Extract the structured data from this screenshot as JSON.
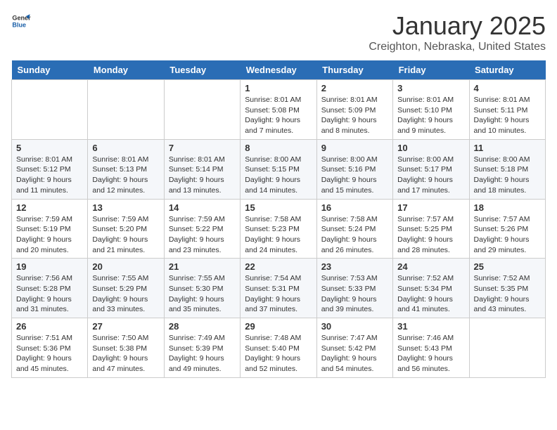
{
  "logo": {
    "general": "General",
    "blue": "Blue"
  },
  "title": "January 2025",
  "location": "Creighton, Nebraska, United States",
  "days_of_week": [
    "Sunday",
    "Monday",
    "Tuesday",
    "Wednesday",
    "Thursday",
    "Friday",
    "Saturday"
  ],
  "weeks": [
    [
      {
        "day": "",
        "detail": ""
      },
      {
        "day": "",
        "detail": ""
      },
      {
        "day": "",
        "detail": ""
      },
      {
        "day": "1",
        "detail": "Sunrise: 8:01 AM\nSunset: 5:08 PM\nDaylight: 9 hours\nand 7 minutes."
      },
      {
        "day": "2",
        "detail": "Sunrise: 8:01 AM\nSunset: 5:09 PM\nDaylight: 9 hours\nand 8 minutes."
      },
      {
        "day": "3",
        "detail": "Sunrise: 8:01 AM\nSunset: 5:10 PM\nDaylight: 9 hours\nand 9 minutes."
      },
      {
        "day": "4",
        "detail": "Sunrise: 8:01 AM\nSunset: 5:11 PM\nDaylight: 9 hours\nand 10 minutes."
      }
    ],
    [
      {
        "day": "5",
        "detail": "Sunrise: 8:01 AM\nSunset: 5:12 PM\nDaylight: 9 hours\nand 11 minutes."
      },
      {
        "day": "6",
        "detail": "Sunrise: 8:01 AM\nSunset: 5:13 PM\nDaylight: 9 hours\nand 12 minutes."
      },
      {
        "day": "7",
        "detail": "Sunrise: 8:01 AM\nSunset: 5:14 PM\nDaylight: 9 hours\nand 13 minutes."
      },
      {
        "day": "8",
        "detail": "Sunrise: 8:00 AM\nSunset: 5:15 PM\nDaylight: 9 hours\nand 14 minutes."
      },
      {
        "day": "9",
        "detail": "Sunrise: 8:00 AM\nSunset: 5:16 PM\nDaylight: 9 hours\nand 15 minutes."
      },
      {
        "day": "10",
        "detail": "Sunrise: 8:00 AM\nSunset: 5:17 PM\nDaylight: 9 hours\nand 17 minutes."
      },
      {
        "day": "11",
        "detail": "Sunrise: 8:00 AM\nSunset: 5:18 PM\nDaylight: 9 hours\nand 18 minutes."
      }
    ],
    [
      {
        "day": "12",
        "detail": "Sunrise: 7:59 AM\nSunset: 5:19 PM\nDaylight: 9 hours\nand 20 minutes."
      },
      {
        "day": "13",
        "detail": "Sunrise: 7:59 AM\nSunset: 5:20 PM\nDaylight: 9 hours\nand 21 minutes."
      },
      {
        "day": "14",
        "detail": "Sunrise: 7:59 AM\nSunset: 5:22 PM\nDaylight: 9 hours\nand 23 minutes."
      },
      {
        "day": "15",
        "detail": "Sunrise: 7:58 AM\nSunset: 5:23 PM\nDaylight: 9 hours\nand 24 minutes."
      },
      {
        "day": "16",
        "detail": "Sunrise: 7:58 AM\nSunset: 5:24 PM\nDaylight: 9 hours\nand 26 minutes."
      },
      {
        "day": "17",
        "detail": "Sunrise: 7:57 AM\nSunset: 5:25 PM\nDaylight: 9 hours\nand 28 minutes."
      },
      {
        "day": "18",
        "detail": "Sunrise: 7:57 AM\nSunset: 5:26 PM\nDaylight: 9 hours\nand 29 minutes."
      }
    ],
    [
      {
        "day": "19",
        "detail": "Sunrise: 7:56 AM\nSunset: 5:28 PM\nDaylight: 9 hours\nand 31 minutes."
      },
      {
        "day": "20",
        "detail": "Sunrise: 7:55 AM\nSunset: 5:29 PM\nDaylight: 9 hours\nand 33 minutes."
      },
      {
        "day": "21",
        "detail": "Sunrise: 7:55 AM\nSunset: 5:30 PM\nDaylight: 9 hours\nand 35 minutes."
      },
      {
        "day": "22",
        "detail": "Sunrise: 7:54 AM\nSunset: 5:31 PM\nDaylight: 9 hours\nand 37 minutes."
      },
      {
        "day": "23",
        "detail": "Sunrise: 7:53 AM\nSunset: 5:33 PM\nDaylight: 9 hours\nand 39 minutes."
      },
      {
        "day": "24",
        "detail": "Sunrise: 7:52 AM\nSunset: 5:34 PM\nDaylight: 9 hours\nand 41 minutes."
      },
      {
        "day": "25",
        "detail": "Sunrise: 7:52 AM\nSunset: 5:35 PM\nDaylight: 9 hours\nand 43 minutes."
      }
    ],
    [
      {
        "day": "26",
        "detail": "Sunrise: 7:51 AM\nSunset: 5:36 PM\nDaylight: 9 hours\nand 45 minutes."
      },
      {
        "day": "27",
        "detail": "Sunrise: 7:50 AM\nSunset: 5:38 PM\nDaylight: 9 hours\nand 47 minutes."
      },
      {
        "day": "28",
        "detail": "Sunrise: 7:49 AM\nSunset: 5:39 PM\nDaylight: 9 hours\nand 49 minutes."
      },
      {
        "day": "29",
        "detail": "Sunrise: 7:48 AM\nSunset: 5:40 PM\nDaylight: 9 hours\nand 52 minutes."
      },
      {
        "day": "30",
        "detail": "Sunrise: 7:47 AM\nSunset: 5:42 PM\nDaylight: 9 hours\nand 54 minutes."
      },
      {
        "day": "31",
        "detail": "Sunrise: 7:46 AM\nSunset: 5:43 PM\nDaylight: 9 hours\nand 56 minutes."
      },
      {
        "day": "",
        "detail": ""
      }
    ]
  ]
}
